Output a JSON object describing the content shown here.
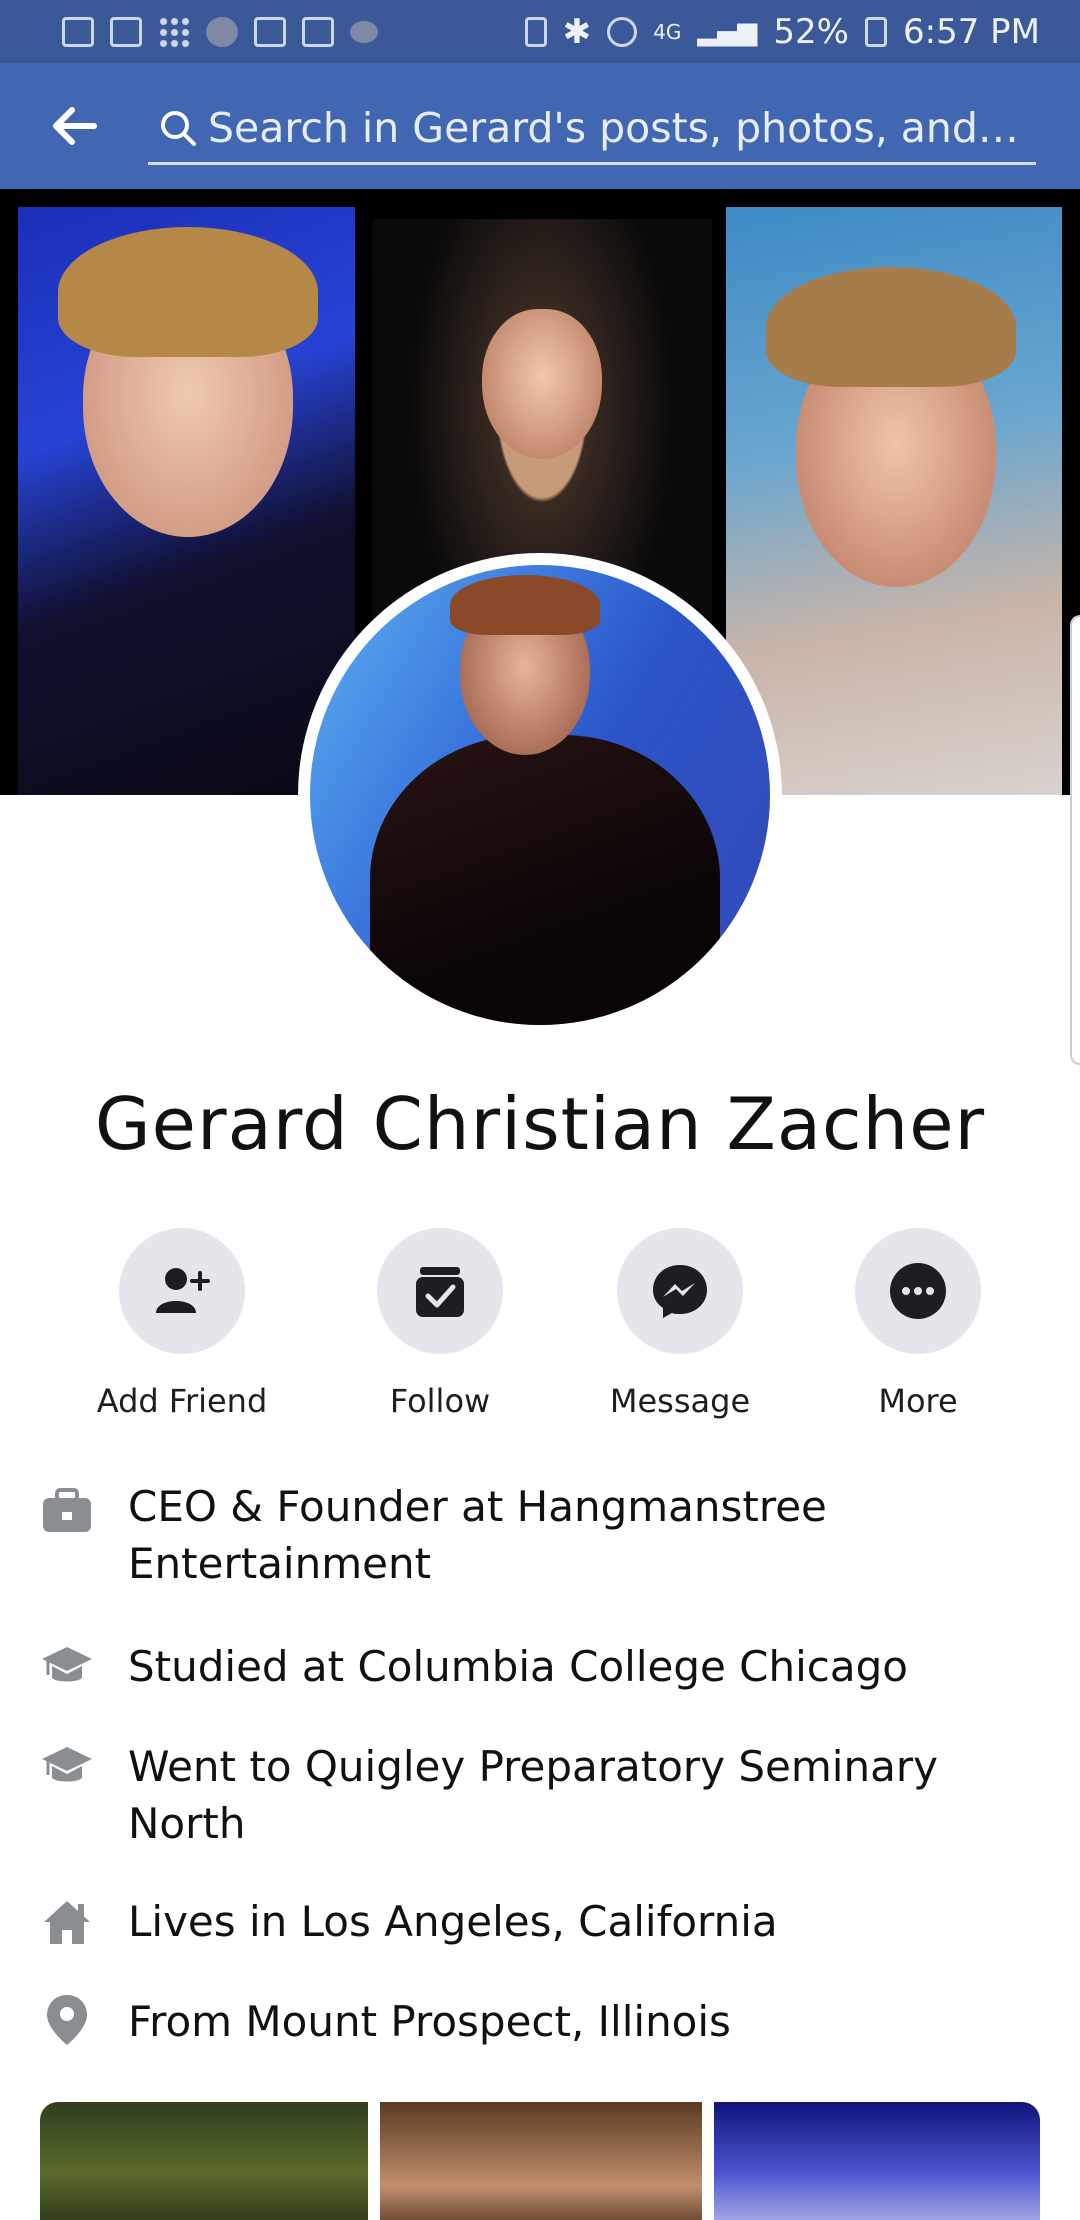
{
  "status_bar": {
    "left_icons": [
      "calendar-icon",
      "mail-icon",
      "dots-icon",
      "circle-icon",
      "card-icon",
      "activity-icon",
      "cloud-icon"
    ],
    "right_icons": [
      "battery-saver-icon",
      "bluetooth-icon",
      "alarm-icon",
      "lte-icon",
      "signal-icon",
      "battery-icon"
    ],
    "network": "4G",
    "battery": "52%",
    "time": "6:57 PM"
  },
  "header": {
    "search_placeholder": "Search in Gerard's posts, photos, and ta..."
  },
  "profile": {
    "name": "Gerard Christian Zacher"
  },
  "actions": [
    {
      "label": "Add Friend",
      "icon": "add-friend-icon"
    },
    {
      "label": "Follow",
      "icon": "follow-icon"
    },
    {
      "label": "Message",
      "icon": "messenger-icon"
    },
    {
      "label": "More",
      "icon": "more-icon"
    }
  ],
  "info": [
    {
      "icon": "briefcase-icon",
      "text": "CEO & Founder at Hangmanstree Entertainment"
    },
    {
      "icon": "graduation-cap-icon",
      "text": "Studied at Columbia College Chicago"
    },
    {
      "icon": "graduation-cap-icon",
      "text": "Went to Quigley Preparatory Seminary North"
    },
    {
      "icon": "home-icon",
      "text": "Lives in Los Angeles, California"
    },
    {
      "icon": "location-pin-icon",
      "text": "From Mount Prospect, Illinois"
    }
  ],
  "colors": {
    "header_blue": "#4267b2",
    "status_blue": "#3b5998",
    "action_bg": "#e4e6eb",
    "icon_dark": "#1c1e21",
    "info_icon_gray": "#8a8d91"
  }
}
